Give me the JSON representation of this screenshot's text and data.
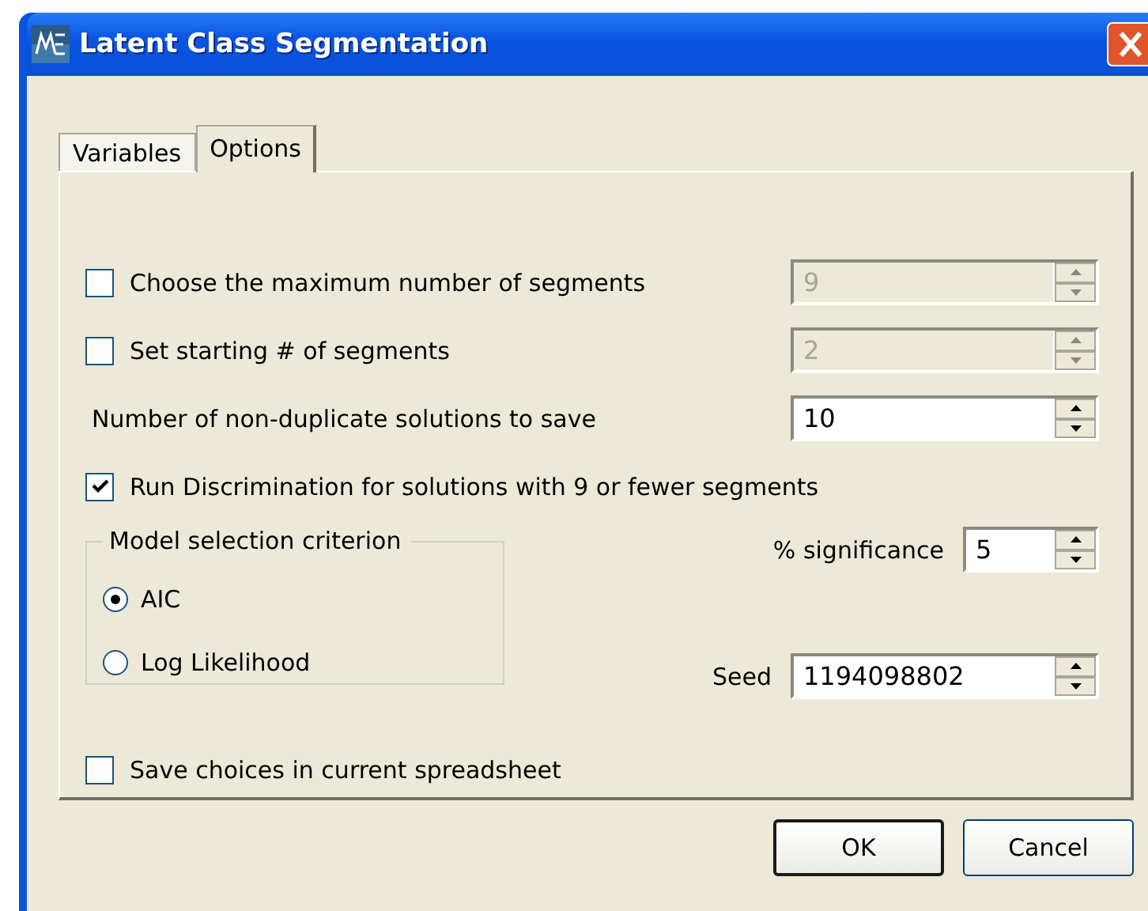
{
  "window": {
    "title": "Latent Class Segmentation"
  },
  "tabs": [
    {
      "label": "Variables",
      "selected": false
    },
    {
      "label": "Options",
      "selected": true
    }
  ],
  "rows": [
    {
      "kind": "checkbox",
      "label": "Choose the maximum number of segments",
      "checked": false,
      "spinner": {
        "value": "9",
        "disabled": true
      }
    },
    {
      "kind": "checkbox",
      "label": "Set starting # of segments",
      "checked": false,
      "spinner": {
        "value": "2",
        "disabled": true
      }
    },
    {
      "kind": "label",
      "label": "Number of non-duplicate solutions to save",
      "spinner": {
        "value": "10",
        "disabled": false
      }
    },
    {
      "kind": "checkbox",
      "label": "Run Discrimination for solutions with 9 or fewer segments",
      "checked": true
    }
  ],
  "criterion": {
    "title": "Model selection criterion",
    "options": [
      {
        "label": "AIC",
        "selected": true
      },
      {
        "label": "Log Likelihood",
        "selected": false
      }
    ]
  },
  "significance": {
    "label": "% significance",
    "value": "5"
  },
  "seed": {
    "label": "Seed",
    "value": "1194098802"
  },
  "save_choices": {
    "label": "Save choices in current spreadsheet",
    "checked": false
  },
  "buttons": [
    {
      "label": "OK",
      "default": true
    },
    {
      "label": "Cancel",
      "default": false
    }
  ]
}
